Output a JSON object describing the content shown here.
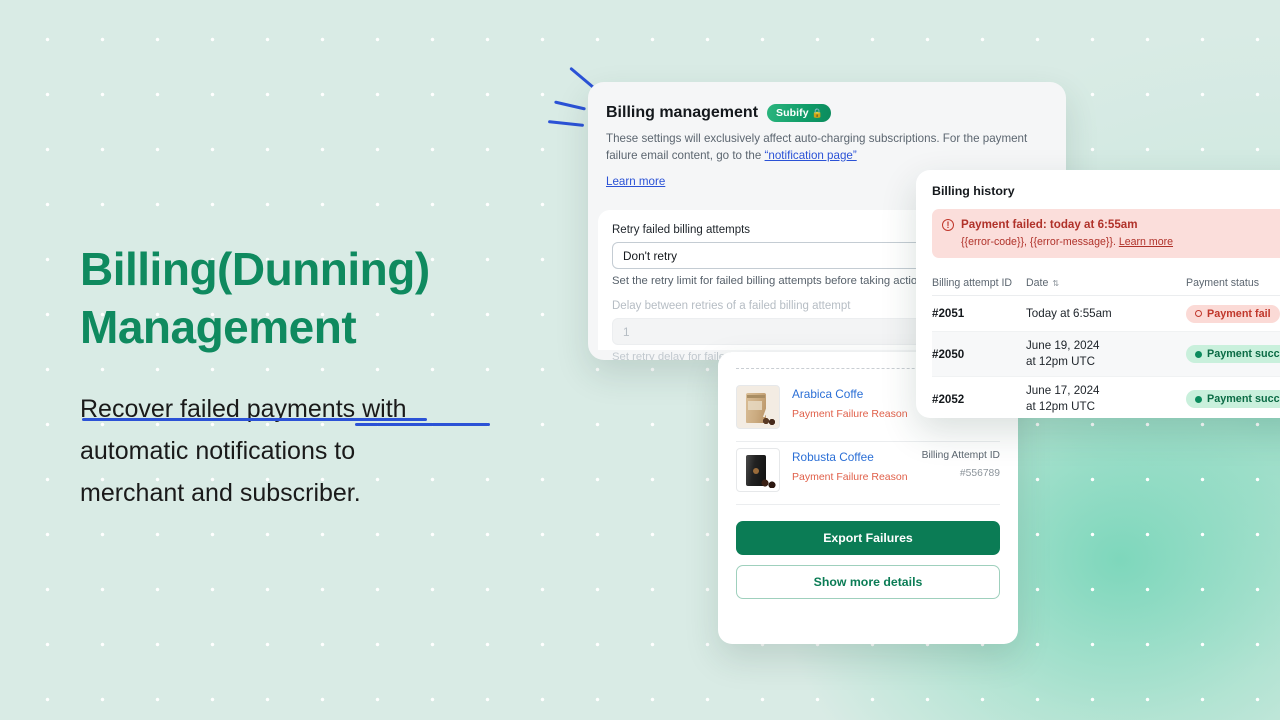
{
  "hero": {
    "headline_line1": "Billing(Dunning)",
    "headline_line2": "Management",
    "sub_line1": "Recover failed payments with",
    "sub_line2": "automatic notifications to",
    "sub_line3": "merchant and subscriber.",
    "headline_color": "#0f8a5f",
    "underline_color": "#2b52d6"
  },
  "settings_card": {
    "title": "Billing management",
    "badge_label": "Subify",
    "badge_icon": "lock-icon",
    "description_part1": "These settings will exclusively affect auto-charging subscriptions. For the payment failure email content, go to the ",
    "description_link": "“notification page”",
    "learn_more": "Learn more",
    "fields": [
      {
        "label": "Retry failed billing attempts",
        "value": "Don't retry",
        "help": "Set the retry limit for failed billing attempts before taking action",
        "type": "select",
        "dimmed": false
      },
      {
        "label": "Delay between retries of a failed billing attempt",
        "value": "1",
        "help": "Set retry delay for failed billing attempts",
        "type": "input",
        "dimmed": true
      }
    ]
  },
  "history_card": {
    "title": "Billing history",
    "alert": {
      "icon": "alert-circle-icon",
      "title": "Payment failed: today at 6:55am",
      "message": "{{error-code}}, {{error-message}}. ",
      "link": "Learn more",
      "bg_color": "#fbdedb",
      "text_color": "#b0322a"
    },
    "columns": [
      "Billing attempt ID",
      "Date",
      "Payment status"
    ],
    "sort_column": "Date",
    "rows": [
      {
        "id": "#2051",
        "date_line1": "Today at 6:55am",
        "date_line2": "",
        "status": "Payment fail",
        "status_type": "fail",
        "has_warning": true
      },
      {
        "id": "#2050",
        "date_line1": "June 19, 2024",
        "date_line2": "at 12pm UTC",
        "status": "Payment success",
        "status_type": "success",
        "has_warning": false
      },
      {
        "id": "#2052",
        "date_line1": "June 17, 2024",
        "date_line2": "at 12pm UTC",
        "status": "Payment success",
        "status_type": "success",
        "has_warning": false
      }
    ]
  },
  "list_card": {
    "products": [
      {
        "name": "Arabica Coffe",
        "reason": "Payment Failure Reason",
        "right_label": "",
        "right_value": "",
        "thumb": "kraft-coffee-bag-image"
      },
      {
        "name": "Robusta Coffee",
        "reason": "Payment Failure Reason",
        "right_label": "Billing Attempt ID",
        "right_value": "#556789",
        "thumb": "black-coffee-bag-image"
      }
    ],
    "primary_button": "Export Failures",
    "secondary_button": "Show more details",
    "primary_color": "#0b7c55"
  }
}
